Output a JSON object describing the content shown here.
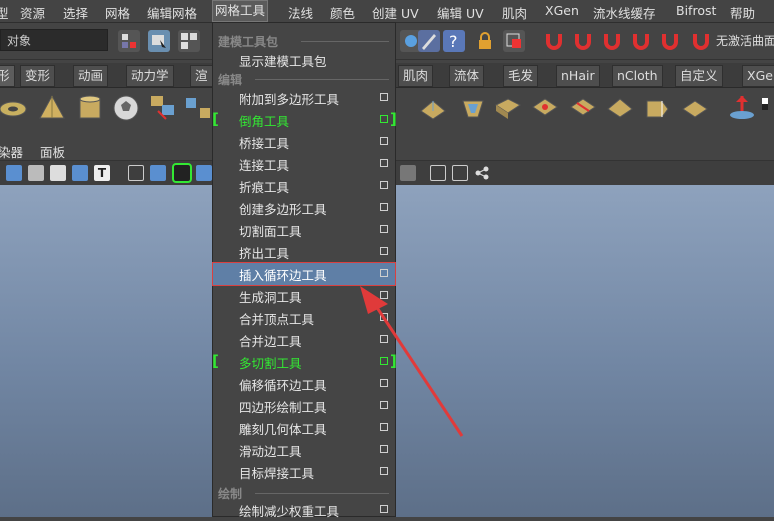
{
  "menubar": {
    "items": [
      "型",
      "资源",
      "选择",
      "网格",
      "编辑网格",
      "网格工具",
      "法线",
      "颜色",
      "创建 UV",
      "编辑 UV",
      "肌肉",
      "XGen",
      "流水线缓存",
      "Bifrost",
      "帮助"
    ]
  },
  "statusline": {
    "object_field": "对象",
    "right_text": "无激活曲面"
  },
  "shelf": {
    "tabs": [
      "形",
      "变形",
      "动画",
      "动力学",
      "渲",
      "肌肉",
      "流体",
      "毛发",
      "nHair",
      "nCloth",
      "自定义",
      "XGe"
    ]
  },
  "panel": {
    "menus": [
      "染器",
      "面板"
    ]
  },
  "dropdown": {
    "section_build": "建模工具包",
    "show_kit": "显示建模工具包",
    "section_edit": "编辑",
    "items": [
      {
        "label": "附加到多边形工具",
        "green": false
      },
      {
        "label": "倒角工具",
        "green": true
      },
      {
        "label": "桥接工具",
        "green": false
      },
      {
        "label": "连接工具",
        "green": false
      },
      {
        "label": "折痕工具",
        "green": false
      },
      {
        "label": "创建多边形工具",
        "green": false
      },
      {
        "label": "切割面工具",
        "green": false
      },
      {
        "label": "挤出工具",
        "green": false
      },
      {
        "label": "插入循环边工具",
        "green": false
      },
      {
        "label": "生成洞工具",
        "green": false
      },
      {
        "label": "合并顶点工具",
        "green": false
      },
      {
        "label": "合并边工具",
        "green": false
      },
      {
        "label": "多切割工具",
        "green": true
      },
      {
        "label": "偏移循环边工具",
        "green": false
      },
      {
        "label": "四边形绘制工具",
        "green": false
      },
      {
        "label": "雕刻几何体工具",
        "green": false
      },
      {
        "label": "滑动边工具",
        "green": false
      },
      {
        "label": "目标焊接工具",
        "green": false
      }
    ],
    "section_paint": "绘制",
    "paint_item": "绘制减少权重工具",
    "highlighted": "插入循环边工具"
  },
  "colors": {
    "accent_green": "#33e833",
    "highlight": "#5f7fa6",
    "annotation_red": "#e03a3a"
  }
}
